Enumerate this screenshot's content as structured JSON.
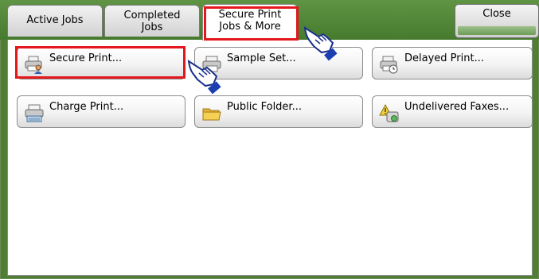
{
  "tabs": [
    {
      "label_line1": "Active Jobs",
      "label_line2": ""
    },
    {
      "label_line1": "Completed",
      "label_line2": "Jobs"
    },
    {
      "label_line1": "Secure Print",
      "label_line2": "Jobs & More"
    }
  ],
  "close_label": "Close",
  "buttons": {
    "secure_print": "Secure Print...",
    "sample_set": "Sample Set...",
    "delayed_print": "Delayed Print...",
    "charge_print": "Charge Print...",
    "public_folder": "Public Folder...",
    "undelivered_faxes": "Undelivered Faxes..."
  },
  "icons": {
    "secure_print": "printer-person-icon",
    "sample_set": "printer-icon",
    "delayed_print": "printer-clock-icon",
    "charge_print": "printer-keypad-icon",
    "public_folder": "folder-icon",
    "undelivered_faxes": "fax-warning-icon",
    "pointer": "pointing-hand-icon"
  },
  "colors": {
    "highlight": "#e3171c",
    "tab_bar_green": "#4e7f35",
    "hand_blue": "#1b3fb0"
  }
}
